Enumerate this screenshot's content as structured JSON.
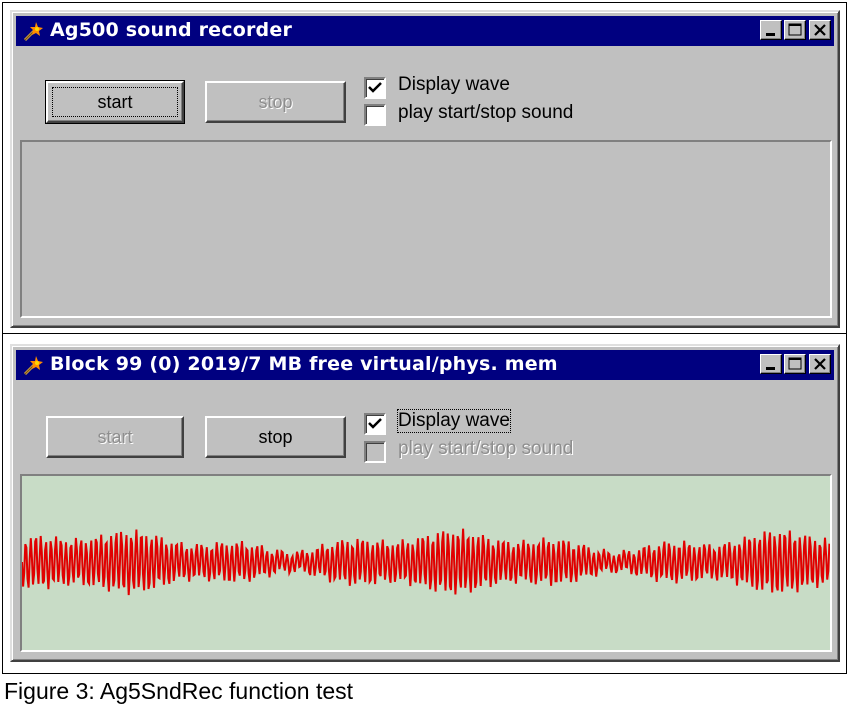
{
  "window1": {
    "title": "Ag500 sound recorder",
    "start_label": "start",
    "stop_label": "stop",
    "display_wave_label": "Display wave",
    "play_sound_label": "play start/stop sound"
  },
  "window2": {
    "title": "Block 99 (0) 2019/7 MB free virtual/phys. mem",
    "start_label": "start",
    "stop_label": "stop",
    "display_wave_label": "Display wave",
    "play_sound_label": "play start/stop sound"
  },
  "caption": "Figure 3:  Ag5SndRec function test",
  "colors": {
    "titlebar": "#000080",
    "window_face": "#c0c0c0",
    "wave_background": "#c8dcc6",
    "wave_color": "#e10000"
  },
  "icons": [
    "app-wand-icon",
    "minimize-icon",
    "maximize-icon",
    "close-icon",
    "checkmark-icon"
  ]
}
